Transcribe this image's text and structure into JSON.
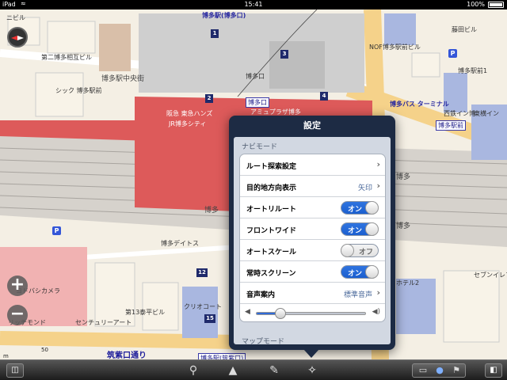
{
  "status_bar": {
    "device": "iPad",
    "time": "15:41",
    "battery": "100%"
  },
  "map": {
    "labels": {
      "hakata_exit": "博多駅(博多口)",
      "hakata_chuo": "博多駅中央街",
      "daini_hakata_soho": "第二博多相互ビル",
      "hakata_eki_mae": "シック\n博多駅前",
      "hakata_guchi": "博多口",
      "hakata_guchi_badge": "博多口",
      "amuplaza": "アミュプラザ博多",
      "hankyu": "阪急 東急ハンズ",
      "jr_city": "JR博多シティ",
      "bus_terminal": "博多バス\nターミナル",
      "nof": "NOF博多駅前ビル",
      "eki_mae_1": "博多駅前1",
      "eki_mae_badge": "博多駅前",
      "fujita": "藤田ビル",
      "tokyu": "東横イン",
      "nishitetsu": "西鉄イン博",
      "hakata_label": "博多",
      "hakata_label2": "博多",
      "hakata_label3": "博多",
      "deitos": "博多デイトス",
      "yodobashi": "ヨドバシカメラ",
      "richmond": "リッチモンド",
      "century_art": "センチュリーアート",
      "dai13": "第13泰平ビル",
      "kuri_court": "クリオコート",
      "seven_eleven": "セブンイレブ",
      "hotel": "ホテル2",
      "chikushi_st": "筑紫口通り",
      "hakata_chikushi": "博多駅(筑紫口)",
      "nibiru": "ニビル"
    },
    "numbers": [
      "1",
      "2",
      "3",
      "4",
      "12",
      "15"
    ],
    "scale": "50 m"
  },
  "popover": {
    "title": "設定",
    "navi_section": "ナビモード",
    "map_section": "マップモード",
    "rows": [
      {
        "label": "ルート探索設定",
        "value": "",
        "type": "disclosure"
      },
      {
        "label": "目的地方向表示",
        "value": "矢印",
        "type": "disclosure"
      },
      {
        "label": "オートリルート",
        "value": "オン",
        "type": "toggle",
        "state": "on"
      },
      {
        "label": "フロントワイド",
        "value": "オン",
        "type": "toggle",
        "state": "on"
      },
      {
        "label": "オートスケール",
        "value": "オフ",
        "type": "toggle",
        "state": "off"
      },
      {
        "label": "常時スクリーン",
        "value": "オン",
        "type": "toggle",
        "state": "on"
      },
      {
        "label": "音声案内",
        "value": "標準音声",
        "type": "disclosure"
      }
    ],
    "volume": 0.22
  },
  "toolbar": {
    "icons": [
      "map-view-icon",
      "search-icon",
      "navigate-icon",
      "ruler-icon",
      "settings-wrench-icon",
      "screen-icon",
      "globe-icon",
      "flag-icon",
      "menu-icon"
    ]
  },
  "colors": {
    "accent_blue": "#2f74e0",
    "station_red": "#dd5a5a",
    "popover_bg": "#1d2b44"
  }
}
